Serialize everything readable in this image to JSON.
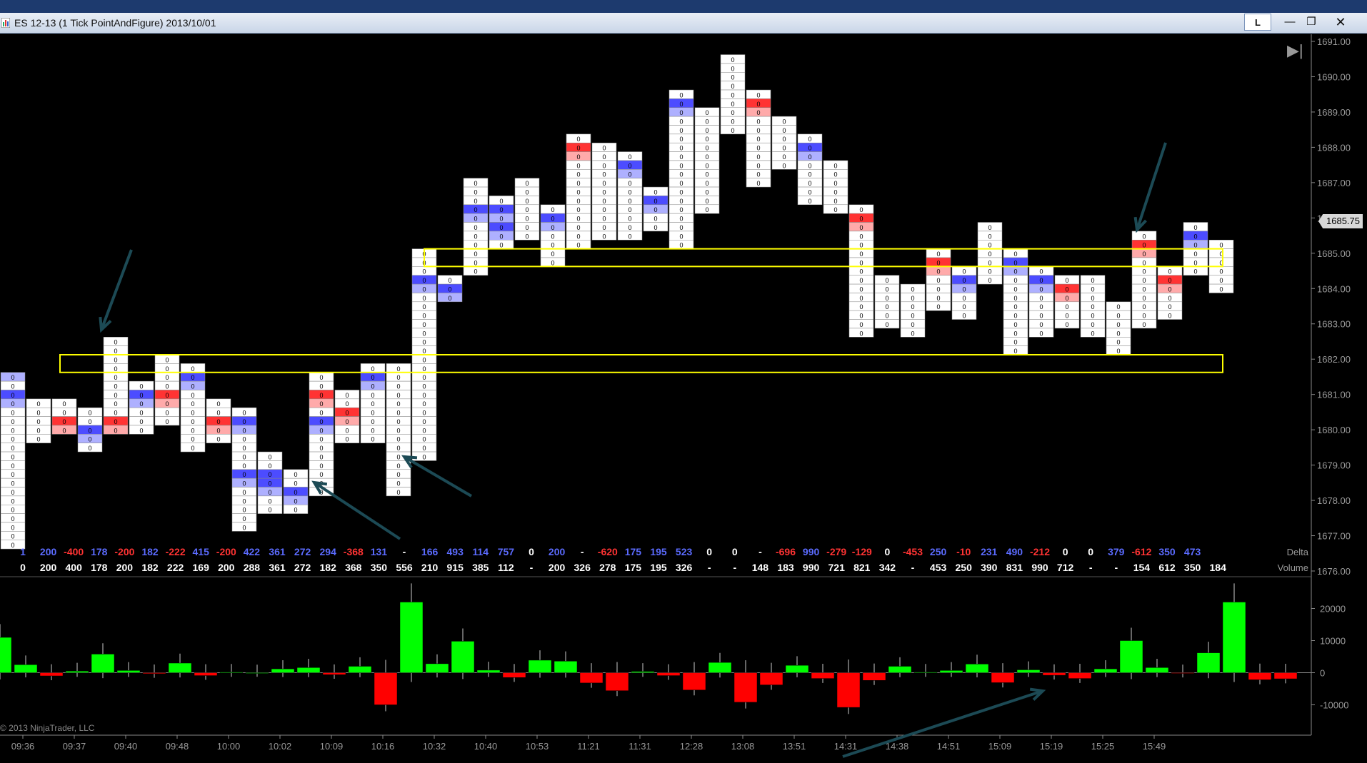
{
  "window": {
    "title": "ES 12-13 (1 Tick PointAndFigure)  2013/10/01",
    "lock_label": "L",
    "minimize_icon": "minimize-icon",
    "maximize_icon": "maximize-icon",
    "close_icon": "close-icon",
    "scroll_end_icon": "scroll-to-end-icon"
  },
  "colors": {
    "background": "#000000",
    "bid_blue": "#4c4cff",
    "ask_red": "#ff3333",
    "up_bar": "#00ff00",
    "down_bar": "#ff0000",
    "zone_box": "#ffff00",
    "arrow": "#1c4a55"
  },
  "price_axis": {
    "labels": [
      "1691.00",
      "1690.00",
      "1689.00",
      "1688.00",
      "1687.00",
      "1686.00",
      "1685.00",
      "1684.00",
      "1683.00",
      "1682.00",
      "1681.00",
      "1680.00",
      "1679.00",
      "1678.00",
      "1677.00",
      "1676.00"
    ],
    "current_price": "1685.75"
  },
  "indicator_axis": {
    "labels": [
      "20000",
      "10000",
      "0",
      "-10000"
    ]
  },
  "stats": {
    "delta_label": "Delta",
    "volume_label": "Volume",
    "delta": [
      "1",
      "200",
      "-400",
      "178",
      "-200",
      "182",
      "-222",
      "415",
      "-200",
      "422",
      "361",
      "272",
      "294",
      "-368",
      "131",
      "-",
      "166",
      "493",
      "114",
      "757",
      "0",
      "200",
      "-",
      "-620",
      "175",
      "195",
      "523",
      "0",
      "0",
      "-",
      "-696",
      "990",
      "-279",
      "-129",
      "0",
      "-453",
      "250",
      "-10",
      "231",
      "490",
      "-212",
      "0",
      "0",
      "379",
      "-612",
      "350",
      "473"
    ],
    "volume": [
      "0",
      "200",
      "400",
      "178",
      "200",
      "182",
      "222",
      "169",
      "200",
      "288",
      "361",
      "272",
      "182",
      "368",
      "350",
      "556",
      "210",
      "915",
      "385",
      "112",
      "-",
      "200",
      "326",
      "278",
      "175",
      "195",
      "326",
      "-",
      "-",
      "148",
      "183",
      "990",
      "721",
      "821",
      "342",
      "-",
      "453",
      "250",
      "390",
      "831",
      "990",
      "712",
      "-",
      "-",
      "154",
      "612",
      "350",
      "184"
    ]
  },
  "time_axis": {
    "labels": [
      "09:36",
      "09:37",
      "09:40",
      "09:48",
      "10:00",
      "10:02",
      "10:09",
      "10:16",
      "10:32",
      "10:40",
      "10:53",
      "11:21",
      "11:31",
      "12:28",
      "13:08",
      "13:51",
      "14:31",
      "14:38",
      "14:51",
      "15:09",
      "15:19",
      "15:25",
      "15:49"
    ]
  },
  "chart_data": {
    "type": "bar",
    "title": "",
    "instrument": "ES 12-13",
    "price_range": [
      1676,
      1691
    ],
    "tick_size": 0.25,
    "columns": [
      {
        "low": 1676.75,
        "high": 1681.5,
        "num_blue": [
          -1,
          2
        ],
        "num_red": []
      },
      {
        "low": 1679.75,
        "high": 1680.75,
        "num_blue": [],
        "num_red": []
      },
      {
        "low": 1680,
        "high": 1680.75,
        "num_blue": [],
        "num_red": [
          2
        ]
      },
      {
        "low": 1679.5,
        "high": 1680.5,
        "num_blue": [
          2
        ],
        "num_red": []
      },
      {
        "low": 1680,
        "high": 1682.5,
        "num_blue": [],
        "num_red": [
          9
        ]
      },
      {
        "low": 1680,
        "high": 1681.25,
        "num_blue": [
          1
        ],
        "num_red": []
      },
      {
        "low": 1680.25,
        "high": 1682,
        "num_blue": [],
        "num_red": [
          4
        ]
      },
      {
        "low": 1679.5,
        "high": 1681.75,
        "num_blue": [
          1
        ],
        "num_red": []
      },
      {
        "low": 1679.75,
        "high": 1680.75,
        "num_blue": [],
        "num_red": [
          2
        ]
      },
      {
        "low": 1677.25,
        "high": 1680.5,
        "num_blue": [
          7,
          1
        ],
        "num_red": []
      },
      {
        "low": 1677.75,
        "high": 1679.25,
        "num_blue": [
          2,
          3
        ],
        "num_red": []
      },
      {
        "low": 1677.75,
        "high": 1678.75,
        "num_blue": [
          2
        ],
        "num_red": []
      },
      {
        "low": 1678.25,
        "high": 1681.5,
        "num_blue": [
          5
        ],
        "num_red": [
          2
        ]
      },
      {
        "low": 1679.75,
        "high": 1681,
        "num_blue": [],
        "num_red": [
          2
        ]
      },
      {
        "low": 1679.75,
        "high": 1681.75,
        "num_blue": [
          1
        ],
        "num_red": []
      },
      {
        "low": 1678.25,
        "high": 1681.75,
        "num_blue": [],
        "num_red": []
      },
      {
        "low": 1679.25,
        "high": 1685.0,
        "num_blue": [
          3
        ],
        "num_red": []
      },
      {
        "low": 1683.75,
        "high": 1684.25,
        "num_blue": [
          1
        ],
        "num_red": []
      },
      {
        "low": 1684.5,
        "high": 1687.0,
        "num_blue": [
          3
        ],
        "num_red": []
      },
      {
        "low": 1685.25,
        "high": 1686.5,
        "num_blue": [
          1,
          3
        ],
        "num_red": []
      },
      {
        "low": 1685.5,
        "high": 1687.0,
        "num_blue": [],
        "num_red": []
      },
      {
        "low": 1684.75,
        "high": 1686.25,
        "num_blue": [
          1
        ],
        "num_red": []
      },
      {
        "low": 1685.25,
        "high": 1688.25,
        "num_blue": [],
        "num_red": [
          1
        ]
      },
      {
        "low": 1685.5,
        "high": 1688.0,
        "num_blue": [],
        "num_red": []
      },
      {
        "low": 1685.5,
        "high": 1687.75,
        "num_blue": [
          1
        ],
        "num_red": []
      },
      {
        "low": 1685.75,
        "high": 1686.75,
        "num_blue": [
          1
        ],
        "num_red": []
      },
      {
        "low": 1685.25,
        "high": 1689.5,
        "num_blue": [
          1
        ],
        "num_red": []
      },
      {
        "low": 1686.25,
        "high": 1689.0,
        "num_blue": [],
        "num_red": []
      },
      {
        "low": 1688.5,
        "high": 1690.5,
        "num_blue": [],
        "num_red": []
      },
      {
        "low": 1687.0,
        "high": 1689.5,
        "num_blue": [],
        "num_red": [
          1
        ]
      },
      {
        "low": 1687.5,
        "high": 1688.75,
        "num_blue": [],
        "num_red": []
      },
      {
        "low": 1686.5,
        "high": 1688.25,
        "num_blue": [
          1
        ],
        "num_red": []
      },
      {
        "low": 1686.25,
        "high": 1687.5,
        "num_blue": [],
        "num_red": []
      },
      {
        "low": 1682.75,
        "high": 1686.25,
        "num_blue": [
          1
        ],
        "num_red": [
          1
        ]
      },
      {
        "low": 1683.0,
        "high": 1684.25,
        "num_blue": [],
        "num_red": []
      },
      {
        "low": 1682.75,
        "high": 1684.0,
        "num_blue": [],
        "num_red": []
      },
      {
        "low": 1683.5,
        "high": 1685.0,
        "num_blue": [],
        "num_red": [
          1
        ]
      },
      {
        "low": 1683.25,
        "high": 1684.5,
        "num_blue": [
          1
        ],
        "num_red": []
      },
      {
        "low": 1684.25,
        "high": 1685.75,
        "num_blue": [],
        "num_red": []
      },
      {
        "low": 1682.25,
        "high": 1685.0,
        "num_blue": [
          1
        ],
        "num_red": []
      },
      {
        "low": 1682.75,
        "high": 1684.5,
        "num_blue": [
          1
        ],
        "num_red": []
      },
      {
        "low": 1683.0,
        "high": 1684.25,
        "num_blue": [
          1
        ],
        "num_red": [
          1
        ]
      },
      {
        "low": 1682.75,
        "high": 1684.25,
        "num_blue": [],
        "num_red": []
      },
      {
        "low": 1682.25,
        "high": 1683.5,
        "num_blue": [],
        "num_red": []
      },
      {
        "low": 1683.0,
        "high": 1685.5,
        "num_blue": [
          1
        ],
        "num_red": [
          1
        ]
      },
      {
        "low": 1683.25,
        "high": 1684.5,
        "num_blue": [],
        "num_red": [
          1
        ]
      },
      {
        "low": 1684.5,
        "high": 1685.75,
        "num_blue": [
          1
        ],
        "num_red": []
      },
      {
        "low": 1684.0,
        "high": 1685.25,
        "num_blue": [],
        "num_red": []
      }
    ],
    "cumulative_delta_bars": [
      11000,
      2500,
      -1000,
      500,
      5800,
      700,
      -300,
      3000,
      -900,
      200,
      0,
      1200,
      1600,
      -600,
      2000,
      -10000,
      22000,
      2800,
      9800,
      800,
      -1500,
      3900,
      3600,
      -3200,
      -5600,
      400,
      -900,
      -5400,
      3200,
      -9200,
      -3800,
      2300,
      -1800,
      -10800,
      -2400,
      2000,
      200,
      700,
      2700,
      -3100,
      900,
      -800,
      -1800,
      1200,
      10000,
      1600,
      -200,
      6200,
      22000,
      -2200,
      -1900
    ],
    "indicator_range": [
      -15000,
      25000
    ],
    "annotations": {
      "zones": [
        [
          1681.75,
          1682.0
        ],
        [
          1684.75,
          1685.0
        ]
      ]
    }
  }
}
